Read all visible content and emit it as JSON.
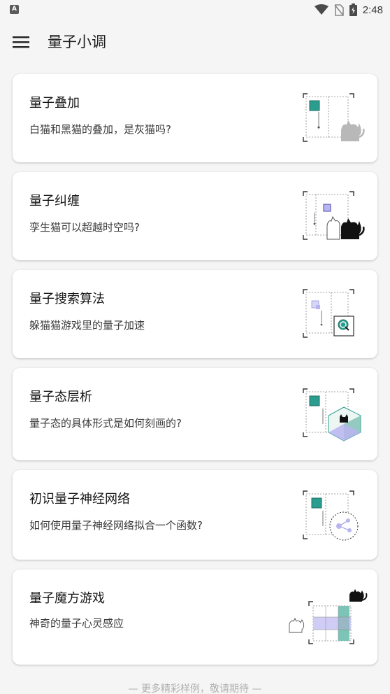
{
  "status_bar": {
    "left_badge": "A",
    "time": "2:48",
    "icons": [
      "wifi-icon",
      "no-sim-icon",
      "battery-charging-icon"
    ]
  },
  "app_bar": {
    "menu_icon": "hamburger-menu-icon",
    "title": "量子小调"
  },
  "cards": [
    {
      "title": "量子叠加",
      "subtitle": "白猫和黑猫的叠加，是灰猫吗?",
      "illustration": "superposition-illustration"
    },
    {
      "title": "量子纠缠",
      "subtitle": "孪生猫可以超越时空吗?",
      "illustration": "entanglement-illustration"
    },
    {
      "title": "量子搜索算法",
      "subtitle": "躲猫猫游戏里的量子加速",
      "illustration": "search-illustration"
    },
    {
      "title": "量子态层析",
      "subtitle": "量子态的具体形式是如何刻画的?",
      "illustration": "tomography-illustration"
    },
    {
      "title": "初识量子神经网络",
      "subtitle": "如何使用量子神经网络拟合一个函数?",
      "illustration": "neural-network-illustration"
    },
    {
      "title": "量子魔方游戏",
      "subtitle": "神奇的量子心灵感应",
      "illustration": "magic-square-illustration"
    }
  ],
  "footer": "— 更多精彩样例，敬请期待 —",
  "colors": {
    "teal": "#2a9d8f",
    "lavender": "#b9b5f0",
    "background": "#f5f5f5",
    "card": "#ffffff"
  }
}
